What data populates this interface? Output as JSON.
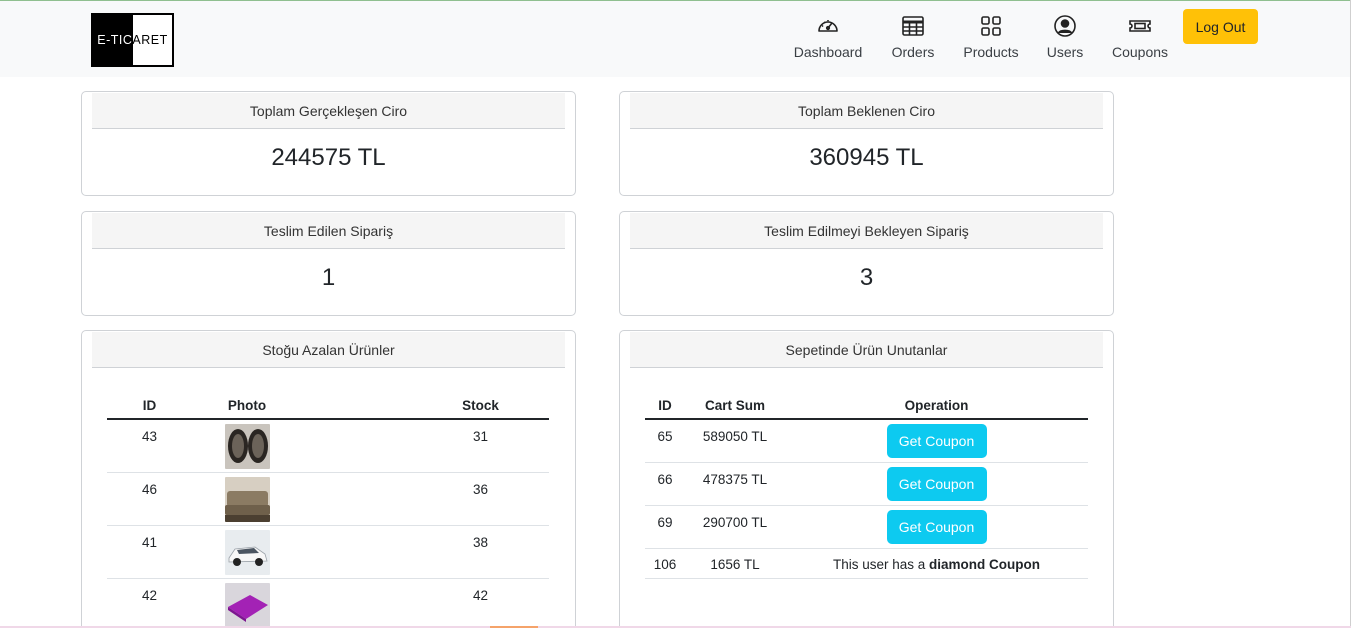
{
  "brand": {
    "logo_left": "E-TIC",
    "logo_right": "ARET"
  },
  "nav": {
    "items": [
      {
        "label": "Dashboard",
        "icon": "speedometer-icon"
      },
      {
        "label": "Orders",
        "icon": "table-icon"
      },
      {
        "label": "Products",
        "icon": "grid-icon"
      },
      {
        "label": "Users",
        "icon": "person-circle-icon"
      },
      {
        "label": "Coupons",
        "icon": "ticket-icon"
      }
    ],
    "logout_label": "Log Out"
  },
  "stats": {
    "realized_revenue": {
      "title": "Toplam Gerçekleşen Ciro",
      "value": "244575 TL"
    },
    "expected_revenue": {
      "title": "Toplam Beklenen Ciro",
      "value": "360945 TL"
    },
    "delivered_orders": {
      "title": "Teslim Edilen Sipariş",
      "value": "1"
    },
    "pending_orders": {
      "title": "Teslim Edilmeyi Bekleyen Sipariş",
      "value": "3"
    }
  },
  "low_stock": {
    "title": "Stoğu Azalan Ürünler",
    "columns": [
      "ID",
      "Photo",
      "Stock"
    ],
    "rows": [
      {
        "id": "43",
        "photo": "mirrors-photo",
        "stock": "31"
      },
      {
        "id": "46",
        "photo": "sofa-photo",
        "stock": "36"
      },
      {
        "id": "41",
        "photo": "car-photo",
        "stock": "38"
      },
      {
        "id": "42",
        "photo": "purple-mat-photo",
        "stock": "42"
      }
    ]
  },
  "abandoned_carts": {
    "title": "Sepetinde Ürün Unutanlar",
    "columns": [
      "ID",
      "Cart Sum",
      "Operation"
    ],
    "rows": [
      {
        "id": "65",
        "sum": "589050 TL",
        "button": "Get Coupon"
      },
      {
        "id": "66",
        "sum": "478375 TL",
        "button": "Get Coupon"
      },
      {
        "id": "69",
        "sum": "290700 TL",
        "button": "Get Coupon"
      },
      {
        "id": "106",
        "sum": "1656 TL",
        "note_prefix": "This user has a",
        "note_strong": "diamond Coupon"
      }
    ]
  },
  "colors": {
    "accent_yellow": "#ffc107",
    "accent_cyan": "#0dcaf0",
    "navbar_bg": "#f8f9fa"
  }
}
